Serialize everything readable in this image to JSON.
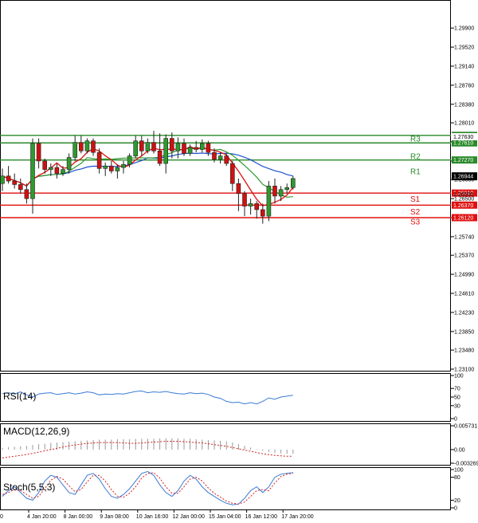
{
  "chart_data": {
    "type": "candlestick",
    "main": {
      "ylim": [
        1.231,
        1.303
      ],
      "y_ticks": [
        "1.29900",
        "1.29520",
        "1.29140",
        "1.28760",
        "1.28380",
        "1.28010",
        "1.27630",
        "1.27250",
        "1.26880",
        "1.26500",
        "1.26120",
        "1.25740",
        "1.25370",
        "1.24990",
        "1.24610",
        "1.24230",
        "1.23850",
        "1.23480",
        "1.23100"
      ],
      "candles": [
        [
          1.268,
          1.271,
          1.2665,
          1.2695
        ],
        [
          1.2695,
          1.2715,
          1.268,
          1.2685
        ],
        [
          1.2685,
          1.27,
          1.267,
          1.2678
        ],
        [
          1.2678,
          1.269,
          1.266,
          1.2668
        ],
        [
          1.2668,
          1.268,
          1.264,
          1.265
        ],
        [
          1.265,
          1.277,
          1.262,
          1.276
        ],
        [
          1.276,
          1.277,
          1.271,
          1.2725
        ],
        [
          1.2725,
          1.273,
          1.27,
          1.2708
        ],
        [
          1.2708,
          1.272,
          1.2695,
          1.2712
        ],
        [
          1.2712,
          1.272,
          1.269,
          1.27
        ],
        [
          1.27,
          1.2715,
          1.2695,
          1.2708
        ],
        [
          1.2708,
          1.274,
          1.27,
          1.2732
        ],
        [
          1.2732,
          1.2775,
          1.2725,
          1.2762
        ],
        [
          1.2762,
          1.2775,
          1.274,
          1.2745
        ],
        [
          1.2745,
          1.277,
          1.274,
          1.2765
        ],
        [
          1.2765,
          1.277,
          1.2735,
          1.2742
        ],
        [
          1.2742,
          1.275,
          1.27,
          1.271
        ],
        [
          1.271,
          1.2722,
          1.2695,
          1.2715
        ],
        [
          1.2715,
          1.2725,
          1.27,
          1.2705
        ],
        [
          1.2705,
          1.2718,
          1.269,
          1.2712
        ],
        [
          1.2712,
          1.2725,
          1.27,
          1.2718
        ],
        [
          1.2718,
          1.274,
          1.2712,
          1.2735
        ],
        [
          1.2735,
          1.2775,
          1.273,
          1.2765
        ],
        [
          1.2765,
          1.2775,
          1.2735,
          1.2745
        ],
        [
          1.2745,
          1.277,
          1.274,
          1.2762
        ],
        [
          1.2762,
          1.2785,
          1.274,
          1.2745
        ],
        [
          1.2745,
          1.278,
          1.2715,
          1.272
        ],
        [
          1.272,
          1.2778,
          1.27,
          1.277
        ],
        [
          1.277,
          1.2782,
          1.273,
          1.2745
        ],
        [
          1.2745,
          1.2772,
          1.273,
          1.276
        ],
        [
          1.276,
          1.277,
          1.2735,
          1.274
        ],
        [
          1.274,
          1.2758,
          1.2735,
          1.2752
        ],
        [
          1.2752,
          1.2765,
          1.2742,
          1.2748
        ],
        [
          1.2748,
          1.2768,
          1.2742,
          1.276
        ],
        [
          1.276,
          1.2765,
          1.2735,
          1.2742
        ],
        [
          1.2742,
          1.275,
          1.2722,
          1.2728
        ],
        [
          1.2728,
          1.2742,
          1.272,
          1.2735
        ],
        [
          1.2735,
          1.274,
          1.2715,
          1.272
        ],
        [
          1.272,
          1.2725,
          1.2665,
          1.268
        ],
        [
          1.268,
          1.269,
          1.2625,
          1.266
        ],
        [
          1.266,
          1.2665,
          1.2615,
          1.2635
        ],
        [
          1.2635,
          1.265,
          1.2618,
          1.264
        ],
        [
          1.264,
          1.2645,
          1.261,
          1.2628
        ],
        [
          1.2628,
          1.264,
          1.26,
          1.2615
        ],
        [
          1.2615,
          1.2685,
          1.2605,
          1.2675
        ],
        [
          1.2675,
          1.269,
          1.264,
          1.2655
        ],
        [
          1.2655,
          1.2675,
          1.2645,
          1.2668
        ],
        [
          1.2668,
          1.268,
          1.266,
          1.2672
        ],
        [
          1.2672,
          1.2695,
          1.2668,
          1.269
        ]
      ],
      "current_price": "1.26944",
      "current_price_value": 1.26944,
      "price_readout": "1.26500",
      "top_readout": "1.27630",
      "ma_red_color": "#e01010",
      "ma_green_color": "#2f9a2f",
      "ma_blue_color": "#2050d0",
      "candle_up_color": "#2e9a2e",
      "candle_down_color": "#d01010"
    },
    "levels": [
      {
        "name": "R3",
        "value": 1.2776,
        "tag": "1.27760",
        "kind": "resistance"
      },
      {
        "name": "",
        "value": 1.2761,
        "tag": "1.27610",
        "kind": "resistance"
      },
      {
        "name": "R2",
        "value": 1.2727,
        "tag": "1.27270",
        "kind": "resistance"
      },
      {
        "name": "R1",
        "value": null,
        "tag": "",
        "kind": "resistance"
      },
      {
        "name": "S1",
        "value": 1.2661,
        "tag": "1.26610",
        "kind": "support"
      },
      {
        "name": "S2",
        "value": 1.2637,
        "tag": "1.26370",
        "kind": "support"
      },
      {
        "name": "S3",
        "value": 1.2612,
        "tag": "1.26120",
        "kind": "support"
      }
    ],
    "rsi": {
      "label": "RSI(14)",
      "ylim": [
        0,
        100
      ],
      "y_ticks": [
        "100",
        "70",
        "50",
        "30",
        "0"
      ],
      "values": [
        58,
        60,
        57,
        62,
        55,
        50,
        57,
        59,
        60,
        56,
        58,
        60,
        57,
        59,
        62,
        60,
        55,
        57,
        56,
        58,
        57,
        60,
        63,
        64,
        60,
        62,
        61,
        63,
        60,
        58,
        57,
        60,
        58,
        59,
        56,
        50,
        47,
        40,
        37,
        38,
        34,
        37,
        34,
        40,
        48,
        45,
        50,
        52,
        54
      ]
    },
    "macd": {
      "label": "MACD(12,26,9)",
      "ylim": [
        -0.003269,
        0.005731
      ],
      "y_ticks": [
        "0.005731",
        "0.00",
        "-0.003269"
      ],
      "histogram": [
        0.0004,
        0.0006,
        0.0007,
        0.0008,
        0.0009,
        0.0011,
        0.0013,
        0.0014,
        0.0016,
        0.0017,
        0.0018,
        0.0019,
        0.002,
        0.0021,
        0.0022,
        0.0023,
        0.0024,
        0.0024,
        0.0024,
        0.0025,
        0.0025,
        0.0025,
        0.0026,
        0.0026,
        0.0026,
        0.0026,
        0.0027,
        0.0027,
        0.0027,
        0.0027,
        0.0026,
        0.0026,
        0.0025,
        0.0024,
        0.0023,
        0.0022,
        0.0021,
        0.002,
        0.0017,
        0.0013,
        0.0009,
        0.0005,
        0.0001,
        -0.0003,
        -0.0006,
        -0.0008,
        -0.0009,
        -0.001,
        -0.001
      ],
      "signal": [
        -0.002,
        -0.0018,
        -0.0016,
        -0.0014,
        -0.0012,
        -0.0009,
        -0.0006,
        -0.0003,
        0.0,
        0.0003,
        0.0006,
        0.0009,
        0.0011,
        0.0013,
        0.0015,
        0.0016,
        0.0017,
        0.0017,
        0.0017,
        0.0017,
        0.0016,
        0.0015,
        0.0015,
        0.0016,
        0.0017,
        0.0018,
        0.0019,
        0.002,
        0.002,
        0.002,
        0.0019,
        0.0018,
        0.0017,
        0.0016,
        0.0014,
        0.0012,
        0.001,
        0.0008,
        0.0005,
        0.0002,
        -0.0001,
        -0.0004,
        -0.0007,
        -0.001,
        -0.0012,
        -0.0014,
        -0.0015,
        -0.0016,
        -0.0016
      ]
    },
    "stoch": {
      "label": "Stoch(5,5,3)",
      "ylim": [
        0,
        100
      ],
      "y_ticks": [
        "100",
        "80",
        "20",
        "0"
      ],
      "k": [
        30,
        45,
        55,
        40,
        25,
        20,
        40,
        70,
        85,
        80,
        60,
        40,
        35,
        60,
        85,
        90,
        75,
        50,
        30,
        25,
        35,
        50,
        70,
        90,
        95,
        85,
        60,
        40,
        30,
        45,
        70,
        85,
        75,
        55,
        40,
        30,
        20,
        12,
        8,
        10,
        25,
        45,
        55,
        40,
        55,
        80,
        88,
        90,
        92
      ],
      "d": [
        35,
        40,
        48,
        45,
        35,
        25,
        30,
        50,
        72,
        82,
        75,
        58,
        42,
        48,
        68,
        85,
        85,
        70,
        48,
        30,
        28,
        38,
        55,
        78,
        90,
        92,
        78,
        55,
        38,
        38,
        55,
        75,
        80,
        70,
        52,
        38,
        28,
        18,
        12,
        10,
        15,
        30,
        45,
        48,
        45,
        65,
        82,
        88,
        90
      ]
    },
    "x_ticks": [
      "4 Jan 20:00",
      "8 Jan 00:00",
      "9 Jan 08:00",
      "10 Jan 16:00",
      "12 Jan 00:00",
      "15 Jan 04:00",
      "16 Jan 12:00",
      "17 Jan 20:00"
    ],
    "x_first_tick": "0"
  }
}
